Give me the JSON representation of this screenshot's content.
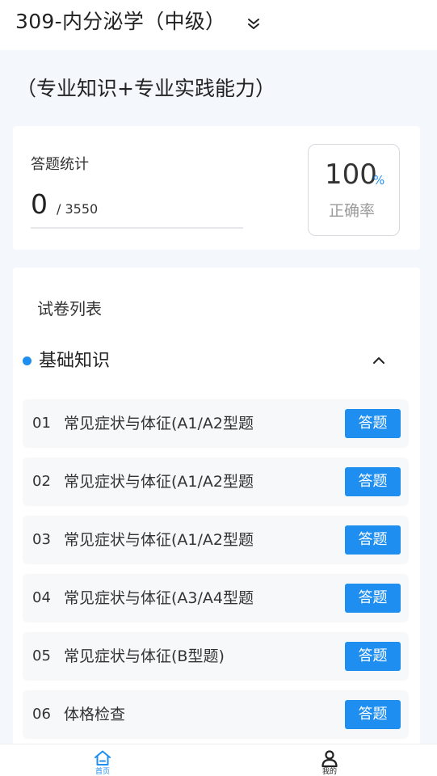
{
  "header": {
    "title": "309-内分泌学（中级）",
    "subtitle": "（专业知识+专业实践能力）"
  },
  "stats": {
    "label": "答题统计",
    "answered": "0",
    "total": "/ 3550",
    "rate_value": "100",
    "rate_unit": "%",
    "rate_label": "正确率"
  },
  "paper_list": {
    "heading": "试卷列表",
    "section_title": "基础知识",
    "button_label": "答题",
    "items": [
      {
        "num": "01",
        "name": "常见症状与体征(A1/A2型题"
      },
      {
        "num": "02",
        "name": "常见症状与体征(A1/A2型题"
      },
      {
        "num": "03",
        "name": "常见症状与体征(A1/A2型题"
      },
      {
        "num": "04",
        "name": "常见症状与体征(A3/A4型题"
      },
      {
        "num": "05",
        "name": "常见症状与体征(B型题)"
      },
      {
        "num": "06",
        "name": "体格检查"
      }
    ]
  },
  "bottom_nav": {
    "home_label": "首页",
    "me_label": "我的"
  },
  "colors": {
    "accent": "#1e8ef0",
    "page_background": "#f4f7fc"
  },
  "icons": {
    "title_dropdown": "double-chevron-down-icon",
    "section_toggle": "chevron-up-icon",
    "home": "home-icon",
    "me": "user-icon"
  }
}
